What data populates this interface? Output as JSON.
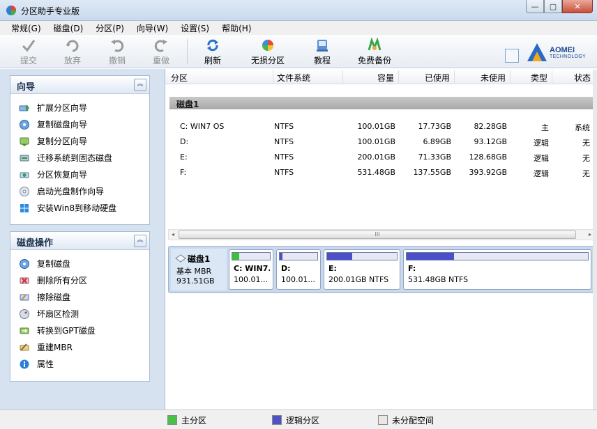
{
  "window": {
    "title": "分区助手专业版",
    "controls": {
      "minimize": "—",
      "restore": "▢",
      "close": "✕"
    }
  },
  "menu": [
    {
      "label": "常规(G)"
    },
    {
      "label": "磁盘(D)"
    },
    {
      "label": "分区(P)"
    },
    {
      "label": "向导(W)"
    },
    {
      "label": "设置(S)"
    },
    {
      "label": "帮助(H)"
    }
  ],
  "toolbar": {
    "commit": "提交",
    "discard": "放弃",
    "undo": "撤销",
    "redo": "重做",
    "refresh": "刷新",
    "lossless_partition": "无损分区",
    "tutorial": "教程",
    "free_backup": "免费备份"
  },
  "brand": {
    "name": "AOMEI",
    "sub": "TECHNOLOGY"
  },
  "wizard_panel": {
    "title": "向导",
    "items": [
      {
        "label": "扩展分区向导"
      },
      {
        "label": "复制磁盘向导"
      },
      {
        "label": "复制分区向导"
      },
      {
        "label": "迁移系统到固态磁盘"
      },
      {
        "label": "分区恢复向导"
      },
      {
        "label": "启动光盘制作向导"
      },
      {
        "label": "安装Win8到移动硬盘"
      }
    ]
  },
  "disk_ops_panel": {
    "title": "磁盘操作",
    "items": [
      {
        "label": "复制磁盘"
      },
      {
        "label": "删除所有分区"
      },
      {
        "label": "擦除磁盘"
      },
      {
        "label": "坏扇区检测"
      },
      {
        "label": "转换到GPT磁盘"
      },
      {
        "label": "重建MBR"
      },
      {
        "label": "属性"
      }
    ]
  },
  "table": {
    "columns": {
      "partition": "分区",
      "filesystem": "文件系统",
      "capacity": "容量",
      "used": "已使用",
      "unused": "未使用",
      "type": "类型",
      "status": "状态"
    },
    "disk_group": "磁盘1",
    "rows": [
      {
        "partition": "C: WIN7 OS",
        "filesystem": "NTFS",
        "capacity": "100.01GB",
        "used": "17.73GB",
        "unused": "82.28GB",
        "type": "主",
        "status": "系统"
      },
      {
        "partition": "D:",
        "filesystem": "NTFS",
        "capacity": "100.01GB",
        "used": "6.89GB",
        "unused": "93.12GB",
        "type": "逻辑",
        "status": "无"
      },
      {
        "partition": "E:",
        "filesystem": "NTFS",
        "capacity": "200.01GB",
        "used": "71.33GB",
        "unused": "128.68GB",
        "type": "逻辑",
        "status": "无"
      },
      {
        "partition": "F:",
        "filesystem": "NTFS",
        "capacity": "531.48GB",
        "used": "137.55GB",
        "unused": "393.92GB",
        "type": "逻辑",
        "status": "无"
      }
    ]
  },
  "scrollbar": {
    "grip": "III"
  },
  "disk_map": {
    "name": "磁盘1",
    "kind": "基本 MBR",
    "size": "931.51GB",
    "partitions": [
      {
        "name": "C: WIN7...",
        "size": "100.01...",
        "used_fraction": 0.18,
        "color": "#3fbf3f"
      },
      {
        "name": "D:",
        "size": "100.01...",
        "used_fraction": 0.07,
        "color": "#4b4fc9"
      },
      {
        "name": "E:",
        "size": "200.01GB NTFS",
        "used_fraction": 0.36,
        "color": "#4b4fc9"
      },
      {
        "name": "F:",
        "size": "531.48GB NTFS",
        "used_fraction": 0.26,
        "color": "#4b4fc9"
      }
    ]
  },
  "legend": {
    "primary": "主分区",
    "logical": "逻辑分区",
    "unallocated": "未分配空间"
  },
  "colors": {
    "primary": "#49c149",
    "logical": "#4d52c8",
    "unallocated": "#ece7e2"
  }
}
